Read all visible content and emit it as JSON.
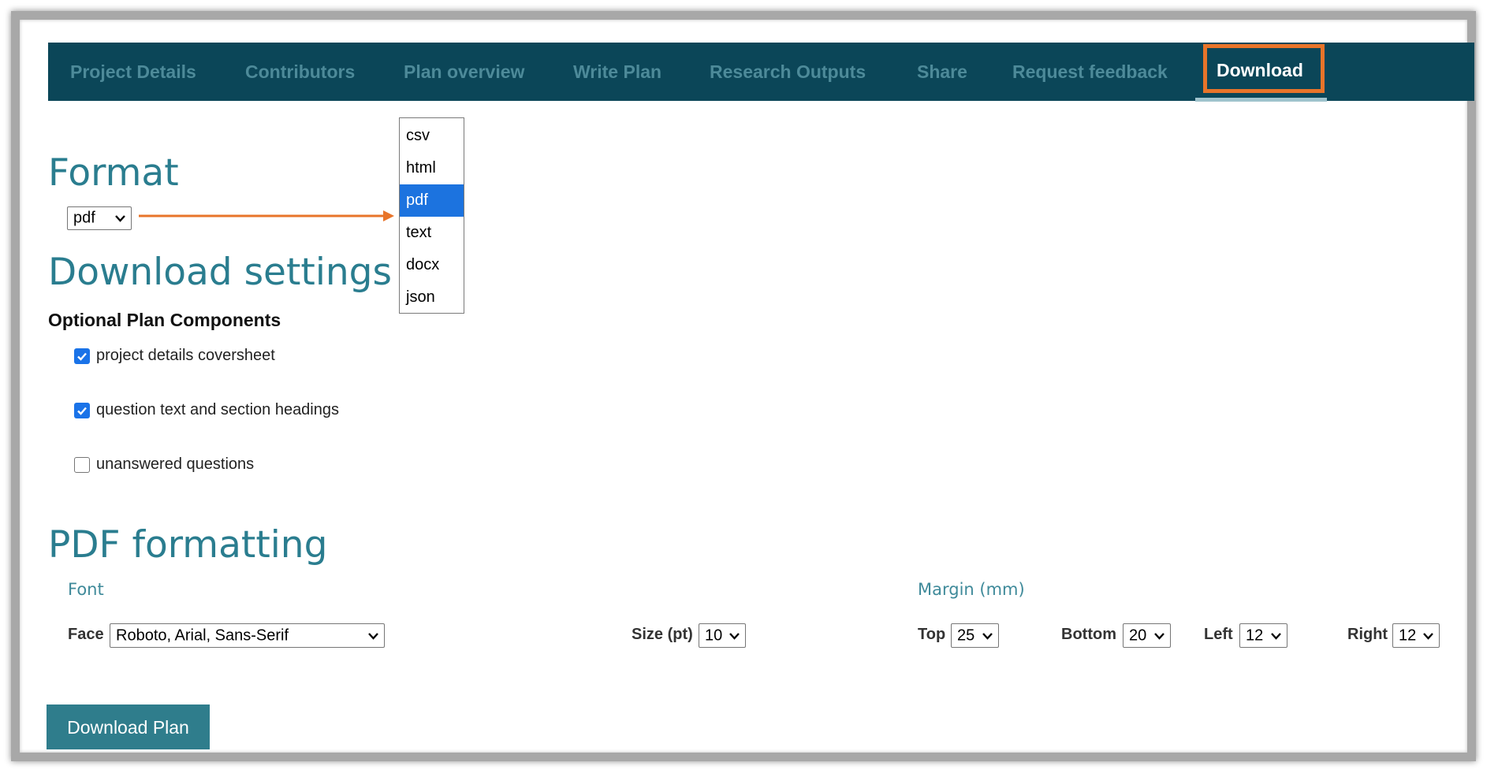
{
  "nav": {
    "items": [
      {
        "label": "Project Details"
      },
      {
        "label": "Contributors"
      },
      {
        "label": "Plan overview"
      },
      {
        "label": "Write Plan"
      },
      {
        "label": "Research Outputs"
      },
      {
        "label": "Share"
      },
      {
        "label": "Request feedback"
      },
      {
        "label": "Download"
      }
    ],
    "active": "Download"
  },
  "format": {
    "heading": "Format",
    "selected": "pdf",
    "options": [
      "csv",
      "html",
      "pdf",
      "text",
      "docx",
      "json"
    ]
  },
  "settings": {
    "heading": "Download settings",
    "subheading": "Optional Plan Components",
    "options": [
      {
        "label": "project details coversheet",
        "checked": true
      },
      {
        "label": "question text and section headings",
        "checked": true
      },
      {
        "label": "unanswered questions",
        "checked": false
      }
    ]
  },
  "pdf": {
    "heading": "PDF formatting",
    "font_label": "Font",
    "margin_label": "Margin (mm)",
    "face_label": "Face",
    "face_value": "Roboto, Arial, Sans-Serif",
    "size_label": "Size (pt)",
    "size_value": "10",
    "top_label": "Top",
    "top_value": "25",
    "bottom_label": "Bottom",
    "bottom_value": "20",
    "left_label": "Left",
    "left_value": "12",
    "right_label": "Right",
    "right_value": "12"
  },
  "download_button": "Download Plan",
  "colors": {
    "nav_bg": "#0b4658",
    "nav_text": "#4d8a99",
    "heading": "#2a7d8f",
    "highlight": "#e8742a",
    "button_bg": "#2f7d8c",
    "selected_option": "#1c73df"
  }
}
